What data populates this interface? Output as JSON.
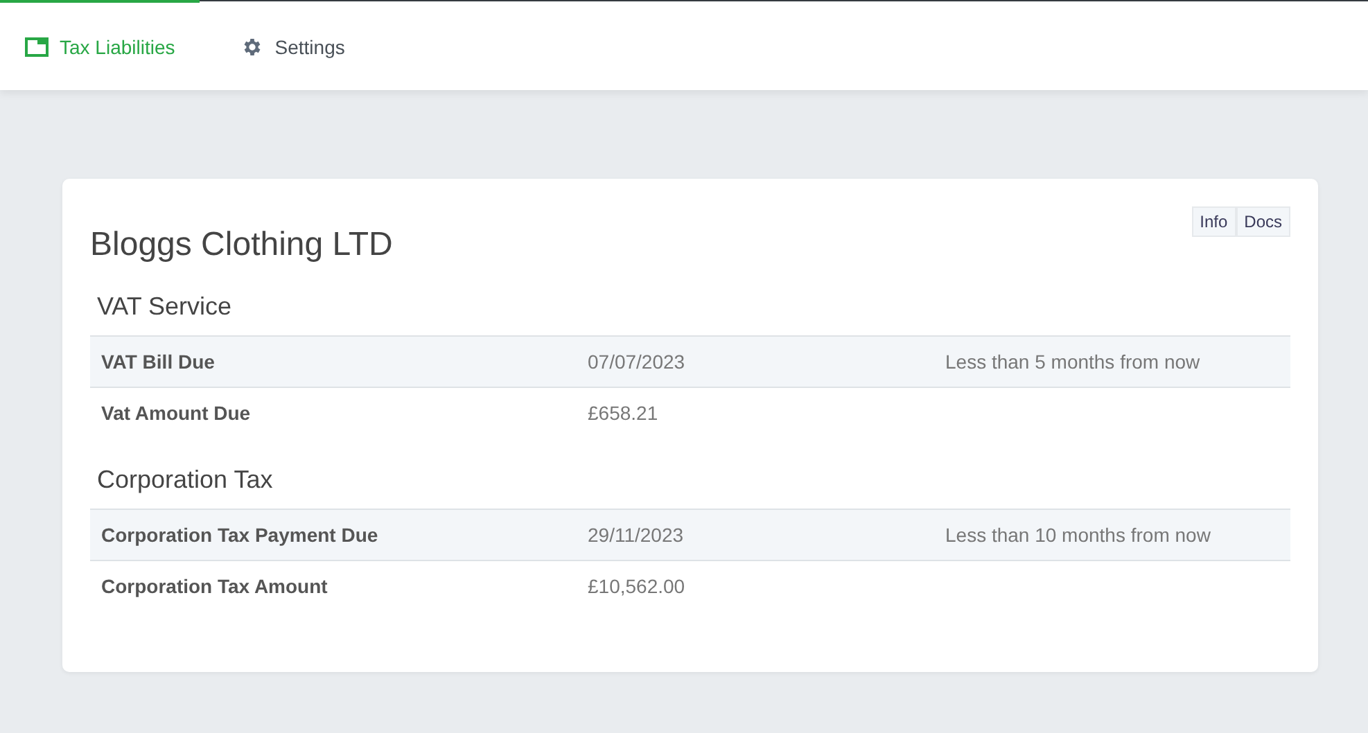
{
  "tabs": [
    {
      "label": "Tax Liabilities",
      "kind": "overview",
      "selected": true
    },
    {
      "label": "Settings",
      "kind": "settings",
      "selected": false
    }
  ],
  "card": {
    "title": "Bloggs Clothing LTD",
    "buttons": [
      "Info",
      "Docs"
    ],
    "sections": [
      {
        "title": "VAT Service",
        "rows": [
          {
            "label": "VAT Bill Due",
            "value": "07/07/2023",
            "note": "Less than 5 months from now"
          },
          {
            "label": "Vat Amount Due",
            "value": "£658.21"
          }
        ]
      },
      {
        "title": "Corporation Tax",
        "rows": [
          {
            "label": "Corporation Tax Payment Due",
            "value": "29/11/2023",
            "note": "Less than 10 months from now"
          },
          {
            "label": "Corporation Tax Amount",
            "value": "£10,562.00"
          }
        ]
      }
    ]
  }
}
